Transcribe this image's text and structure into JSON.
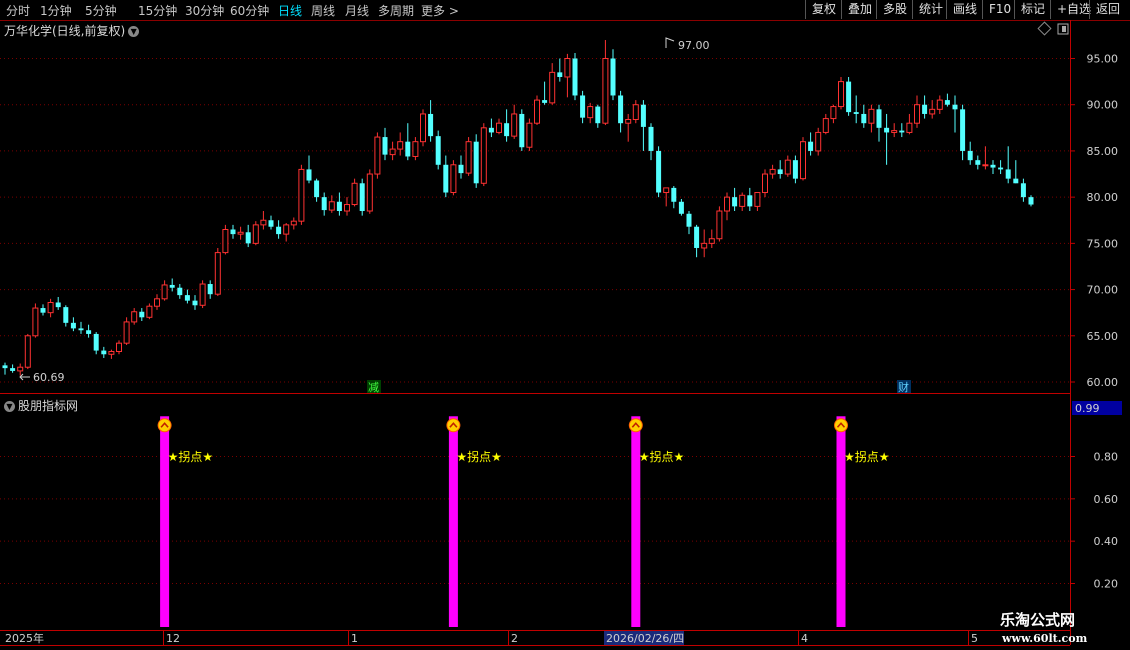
{
  "toolbar": {
    "periods": [
      "分时",
      "1分钟",
      "5分钟",
      "15分钟",
      "30分钟",
      "60分钟",
      "日线",
      "周线",
      "月线",
      "多周期",
      "更多 >"
    ],
    "active_period": "日线",
    "buttons": [
      "复权",
      "叠加",
      "多股",
      "统计",
      "画线",
      "F10",
      "标记",
      "+自选",
      "返回"
    ]
  },
  "main_chart": {
    "title": "万华化学(日线,前复权)",
    "high_annotation": "97.00",
    "low_annotation": "60.69",
    "event_tags": [
      "减",
      "财"
    ],
    "y_ticks": [
      "95.00",
      "90.00",
      "85.00",
      "80.00",
      "75.00",
      "70.00",
      "65.00",
      "60.00"
    ]
  },
  "indicator": {
    "title": "股朋指标网",
    "signal_label": "★拐点★",
    "current_value": "0.99",
    "y_ticks": [
      "0.80",
      "0.60",
      "0.40",
      "0.20"
    ]
  },
  "time_axis": {
    "labels": [
      "2025年",
      "12",
      "1",
      "2",
      "2026/02/26/四",
      "4",
      "5"
    ]
  },
  "watermark": {
    "name": "乐淘公式网",
    "url": "www.60lt.com"
  },
  "colors": {
    "up": "#ff3232",
    "down": "#54ffff",
    "signal": "#ff00ff",
    "label": "#ffff00",
    "grid": "#7a0000"
  },
  "chart_data": {
    "type": "candlestick",
    "ylim": [
      59,
      98
    ],
    "candles": [
      [
        61.8,
        62.1,
        60.8,
        61.5
      ],
      [
        61.5,
        61.9,
        61.0,
        61.2
      ],
      [
        61.2,
        62.0,
        60.7,
        61.6
      ],
      [
        61.6,
        65.2,
        61.4,
        65.0
      ],
      [
        65.0,
        68.5,
        64.8,
        68.0
      ],
      [
        68.0,
        68.4,
        67.2,
        67.5
      ],
      [
        67.5,
        69.0,
        67.0,
        68.6
      ],
      [
        68.6,
        69.2,
        67.8,
        68.1
      ],
      [
        68.1,
        68.3,
        66.0,
        66.4
      ],
      [
        66.4,
        67.0,
        65.5,
        65.8
      ],
      [
        65.8,
        66.5,
        65.2,
        65.6
      ],
      [
        65.6,
        66.2,
        64.8,
        65.2
      ],
      [
        65.2,
        65.4,
        63.0,
        63.4
      ],
      [
        63.4,
        63.8,
        62.6,
        63.0
      ],
      [
        63.0,
        63.5,
        62.5,
        63.3
      ],
      [
        63.3,
        64.5,
        63.0,
        64.2
      ],
      [
        64.2,
        67.0,
        64.0,
        66.5
      ],
      [
        66.5,
        68.0,
        66.2,
        67.6
      ],
      [
        67.6,
        68.0,
        66.6,
        67.0
      ],
      [
        67.0,
        68.5,
        66.8,
        68.2
      ],
      [
        68.2,
        69.5,
        67.8,
        69.0
      ],
      [
        69.0,
        71.0,
        68.8,
        70.5
      ],
      [
        70.5,
        71.2,
        69.8,
        70.2
      ],
      [
        70.2,
        70.6,
        69.0,
        69.4
      ],
      [
        69.4,
        70.0,
        68.5,
        68.8
      ],
      [
        68.8,
        69.4,
        67.8,
        68.3
      ],
      [
        68.3,
        71.0,
        68.0,
        70.6
      ],
      [
        70.6,
        71.0,
        69.0,
        69.5
      ],
      [
        69.5,
        74.5,
        69.3,
        74.0
      ],
      [
        74.0,
        77.0,
        73.8,
        76.5
      ],
      [
        76.5,
        77.0,
        75.5,
        76.0
      ],
      [
        76.0,
        76.8,
        75.4,
        76.2
      ],
      [
        76.2,
        77.0,
        74.6,
        75.0
      ],
      [
        75.0,
        77.4,
        74.8,
        77.0
      ],
      [
        77.0,
        78.5,
        76.5,
        77.5
      ],
      [
        77.5,
        78.0,
        76.5,
        76.8
      ],
      [
        76.8,
        77.5,
        75.5,
        76.0
      ],
      [
        76.0,
        77.2,
        75.2,
        77.0
      ],
      [
        77.0,
        77.8,
        76.5,
        77.4
      ],
      [
        77.4,
        83.5,
        77.0,
        83.0
      ],
      [
        83.0,
        84.5,
        81.5,
        81.8
      ],
      [
        81.8,
        82.0,
        79.5,
        80.0
      ],
      [
        80.0,
        80.5,
        78.0,
        78.6
      ],
      [
        78.6,
        80.2,
        78.3,
        79.5
      ],
      [
        79.5,
        80.5,
        78.0,
        78.5
      ],
      [
        78.5,
        80.0,
        78.0,
        79.2
      ],
      [
        79.2,
        82.0,
        79.0,
        81.5
      ],
      [
        81.5,
        82.0,
        78.0,
        78.5
      ],
      [
        78.5,
        83.0,
        78.2,
        82.5
      ],
      [
        82.5,
        87.0,
        82.0,
        86.5
      ],
      [
        86.5,
        87.5,
        84.0,
        84.6
      ],
      [
        84.6,
        86.0,
        84.0,
        85.2
      ],
      [
        85.2,
        87.0,
        84.5,
        86.0
      ],
      [
        86.0,
        88.0,
        84.0,
        84.4
      ],
      [
        84.4,
        86.5,
        84.0,
        86.0
      ],
      [
        86.0,
        89.5,
        85.5,
        89.0
      ],
      [
        89.0,
        90.5,
        86.0,
        86.6
      ],
      [
        86.6,
        87.2,
        83.0,
        83.5
      ],
      [
        83.5,
        84.5,
        80.0,
        80.5
      ],
      [
        80.5,
        84.0,
        80.2,
        83.5
      ],
      [
        83.5,
        84.5,
        82.0,
        82.6
      ],
      [
        82.6,
        86.5,
        82.3,
        86.0
      ],
      [
        86.0,
        86.8,
        81.0,
        81.5
      ],
      [
        81.5,
        88.0,
        81.2,
        87.5
      ],
      [
        87.5,
        88.5,
        86.5,
        87.0
      ],
      [
        87.0,
        88.5,
        86.8,
        88.0
      ],
      [
        88.0,
        89.5,
        86.0,
        86.6
      ],
      [
        86.6,
        90.0,
        86.3,
        89.0
      ],
      [
        89.0,
        89.5,
        85.0,
        85.4
      ],
      [
        85.4,
        88.5,
        85.0,
        88.0
      ],
      [
        88.0,
        91.0,
        87.8,
        90.5
      ],
      [
        90.5,
        92.5,
        90.0,
        90.2
      ],
      [
        90.2,
        94.5,
        90.0,
        93.5
      ],
      [
        93.5,
        95.0,
        92.5,
        93.0
      ],
      [
        93.0,
        95.5,
        90.8,
        95.0
      ],
      [
        95.0,
        95.6,
        90.5,
        91.0
      ],
      [
        91.0,
        91.5,
        88.0,
        88.6
      ],
      [
        88.6,
        90.2,
        88.0,
        89.8
      ],
      [
        89.8,
        90.0,
        87.5,
        88.0
      ],
      [
        88.0,
        97.0,
        87.8,
        95.0
      ],
      [
        95.0,
        96.0,
        90.5,
        91.0
      ],
      [
        91.0,
        91.5,
        87.0,
        88.0
      ],
      [
        88.0,
        89.0,
        86.0,
        88.4
      ],
      [
        88.4,
        90.5,
        88.0,
        90.0
      ],
      [
        90.0,
        90.5,
        85.0,
        87.6
      ],
      [
        87.6,
        88.0,
        84.0,
        85.0
      ],
      [
        85.0,
        85.5,
        80.0,
        80.5
      ],
      [
        80.5,
        81.0,
        79.0,
        81.0
      ],
      [
        81.0,
        81.2,
        78.8,
        79.5
      ],
      [
        79.5,
        79.8,
        78.0,
        78.2
      ],
      [
        78.2,
        78.5,
        76.0,
        76.8
      ],
      [
        76.8,
        77.0,
        73.5,
        74.5
      ],
      [
        74.5,
        76.5,
        73.5,
        75.0
      ],
      [
        75.0,
        76.5,
        74.5,
        75.5
      ],
      [
        75.5,
        79.0,
        75.2,
        78.5
      ],
      [
        78.5,
        80.5,
        77.5,
        80.0
      ],
      [
        80.0,
        81.0,
        78.5,
        79.0
      ],
      [
        79.0,
        80.5,
        78.5,
        80.2
      ],
      [
        80.2,
        81.0,
        78.5,
        79.0
      ],
      [
        79.0,
        80.5,
        78.5,
        80.5
      ],
      [
        80.5,
        83.0,
        80.0,
        82.5
      ],
      [
        82.5,
        83.5,
        82.0,
        83.0
      ],
      [
        83.0,
        84.0,
        82.0,
        82.5
      ],
      [
        82.5,
        84.5,
        82.2,
        84.0
      ],
      [
        84.0,
        84.5,
        81.5,
        82.0
      ],
      [
        82.0,
        86.5,
        81.8,
        86.0
      ],
      [
        86.0,
        87.0,
        84.5,
        85.0
      ],
      [
        85.0,
        87.5,
        84.5,
        87.0
      ],
      [
        87.0,
        89.0,
        86.8,
        88.5
      ],
      [
        88.5,
        90.0,
        88.0,
        89.8
      ],
      [
        89.8,
        93.0,
        89.5,
        92.5
      ],
      [
        92.5,
        93.0,
        88.8,
        89.2
      ],
      [
        89.2,
        91.0,
        88.0,
        89.0
      ],
      [
        89.0,
        90.0,
        87.5,
        88.0
      ],
      [
        88.0,
        90.0,
        87.0,
        89.5
      ],
      [
        89.5,
        90.0,
        86.0,
        87.5
      ],
      [
        87.5,
        89.0,
        83.5,
        87.0
      ],
      [
        87.0,
        88.0,
        86.5,
        87.2
      ],
      [
        87.2,
        88.0,
        86.5,
        87.0
      ],
      [
        87.0,
        89.0,
        86.8,
        88.0
      ],
      [
        88.0,
        91.0,
        87.5,
        90.0
      ],
      [
        90.0,
        91.0,
        88.5,
        89.0
      ],
      [
        89.0,
        90.5,
        88.5,
        89.5
      ],
      [
        89.5,
        91.0,
        89.0,
        90.5
      ],
      [
        90.5,
        91.2,
        89.8,
        90.0
      ],
      [
        90.0,
        91.0,
        87.0,
        89.5
      ],
      [
        89.5,
        90.0,
        84.0,
        85.0
      ],
      [
        85.0,
        86.0,
        83.5,
        84.0
      ],
      [
        84.0,
        84.5,
        83.0,
        83.5
      ],
      [
        83.5,
        85.5,
        83.0,
        83.5
      ],
      [
        83.5,
        84.0,
        82.5,
        83.2
      ],
      [
        83.2,
        84.0,
        82.5,
        83.0
      ],
      [
        83.0,
        85.5,
        81.5,
        82.0
      ],
      [
        82.0,
        84.0,
        81.5,
        81.5
      ],
      [
        81.5,
        82.0,
        79.5,
        80.0
      ],
      [
        80.0,
        80.2,
        79.0,
        79.2
      ]
    ],
    "signals": [
      {
        "index": 21,
        "value": 0.99
      },
      {
        "index": 59,
        "value": 0.99
      },
      {
        "index": 83,
        "value": 0.99
      },
      {
        "index": 110,
        "value": 0.99
      }
    ]
  }
}
